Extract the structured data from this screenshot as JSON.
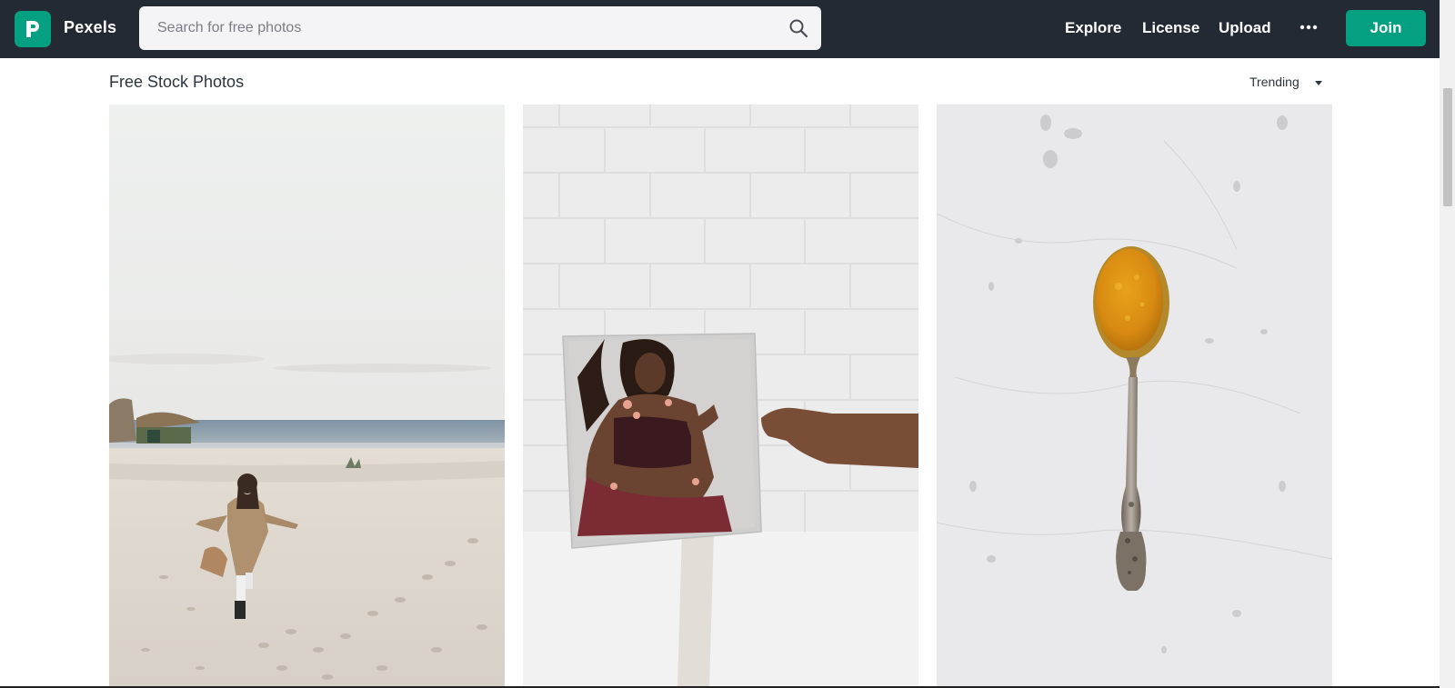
{
  "header": {
    "brand": "Pexels",
    "logo_icon": "pexels-logo-icon",
    "search": {
      "placeholder": "Search for free photos",
      "value": ""
    },
    "nav": [
      "Explore",
      "License",
      "Upload"
    ],
    "more_icon": "more-dots-icon",
    "join_label": "Join"
  },
  "main": {
    "section_title": "Free Stock Photos",
    "sort": {
      "selected": "Trending"
    },
    "photos": [
      {
        "subject": "beach-woman-running-photo"
      },
      {
        "subject": "mirror-reflection-woman-photo"
      },
      {
        "subject": "turmeric-spoon-marble-photo"
      }
    ]
  },
  "colors": {
    "header_bg": "#232a34",
    "accent": "#05a081",
    "search_bg": "#f4f4f6",
    "text_dark": "#2c343e"
  }
}
